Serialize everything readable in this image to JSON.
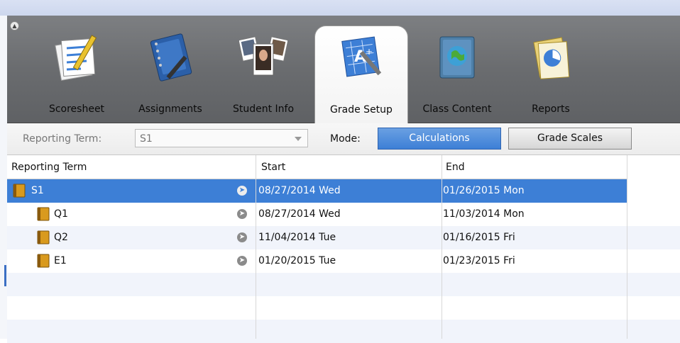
{
  "tabs": [
    {
      "label": "Scoresheet",
      "icon": "scoresheet-icon"
    },
    {
      "label": "Assignments",
      "icon": "assignments-notebook-icon"
    },
    {
      "label": "Student Info",
      "icon": "student-photos-icon"
    },
    {
      "label": "Grade Setup",
      "icon": "grade-setup-blueprint-icon",
      "active": true
    },
    {
      "label": "Class Content",
      "icon": "class-content-globe-book-icon"
    },
    {
      "label": "Reports",
      "icon": "reports-pie-chart-icon"
    }
  ],
  "toolbar": {
    "reporting_term_label": "Reporting Term:",
    "reporting_term_value": "S1",
    "mode_label": "Mode:",
    "calculations_label": "Calculations",
    "grade_scales_label": "Grade Scales"
  },
  "table": {
    "headers": [
      "Reporting Term",
      "Start",
      "End"
    ],
    "rows": [
      {
        "term": "S1",
        "start": "08/27/2014 Wed",
        "end": "01/26/2015 Mon",
        "level": 0,
        "selected": true
      },
      {
        "term": "Q1",
        "start": "08/27/2014 Wed",
        "end": "11/03/2014 Mon",
        "level": 1
      },
      {
        "term": "Q2",
        "start": "11/04/2014 Tue",
        "end": "01/16/2015 Fri",
        "level": 1
      },
      {
        "term": "E1",
        "start": "01/20/2015 Tue",
        "end": "01/23/2015 Fri",
        "level": 1
      }
    ]
  },
  "colors": {
    "accent": "#3d7fd6",
    "toolbar": "#6a6c6f",
    "book": "#d99a1e"
  }
}
